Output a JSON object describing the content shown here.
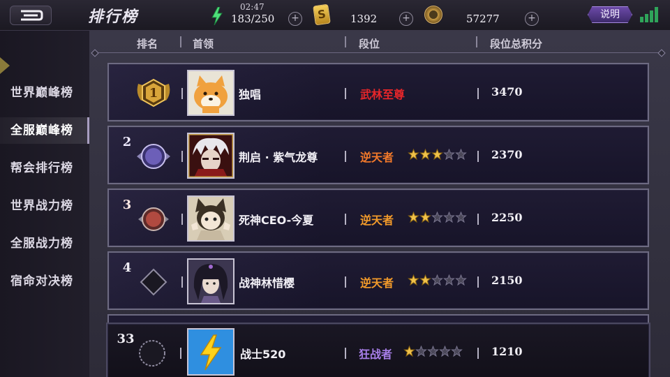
{
  "topbar": {
    "title": "排行榜",
    "stamina_timer": "02:47",
    "stamina": "183/250",
    "s_coin": "1392",
    "gold": "57277",
    "help_label": "说明"
  },
  "sidebar": {
    "items": [
      {
        "label": "世界巅峰榜",
        "active": false
      },
      {
        "label": "全服巅峰榜",
        "active": true
      },
      {
        "label": "帮会排行榜",
        "active": false
      },
      {
        "label": "世界战力榜",
        "active": false
      },
      {
        "label": "全服战力榜",
        "active": false
      },
      {
        "label": "宿命对决榜",
        "active": false
      }
    ]
  },
  "table": {
    "headers": {
      "rank": "排名",
      "leader": "首领",
      "tier": "段位",
      "score": "段位总积分"
    },
    "rows": [
      {
        "rank": "1",
        "name": "独唱",
        "tier": "武林至尊",
        "tier_color": "#e8262a",
        "stars": 0,
        "stars_total": 0,
        "score": "3470",
        "badge": "gold",
        "avatar": "shiba"
      },
      {
        "rank": "2",
        "name": "荆启 · 紫气龙尊",
        "tier": "逆天者",
        "tier_color": "#f2792a",
        "stars": 3,
        "stars_total": 5,
        "score": "2370",
        "badge": "purple",
        "avatar": "white-hair"
      },
      {
        "rank": "3",
        "name": "死神CEO-今夏",
        "tier": "逆天者",
        "tier_color": "#f29a2a",
        "stars": 2,
        "stars_total": 5,
        "score": "2250",
        "badge": "red",
        "avatar": "cat-ears"
      },
      {
        "rank": "4",
        "name": "战神林惜樱",
        "tier": "逆天者",
        "tier_color": "#f29a2a",
        "stars": 2,
        "stars_total": 5,
        "score": "2150",
        "badge": "plain",
        "avatar": "dark-hair"
      }
    ],
    "my_row": {
      "rank": "33",
      "name": "战士520",
      "tier": "狂战者",
      "tier_color": "#a77ee8",
      "stars": 1,
      "stars_total": 5,
      "score": "1210",
      "avatar": "lightning"
    }
  },
  "colors": {
    "star_on": "#f0c24a",
    "star_off": "#4a4758"
  }
}
